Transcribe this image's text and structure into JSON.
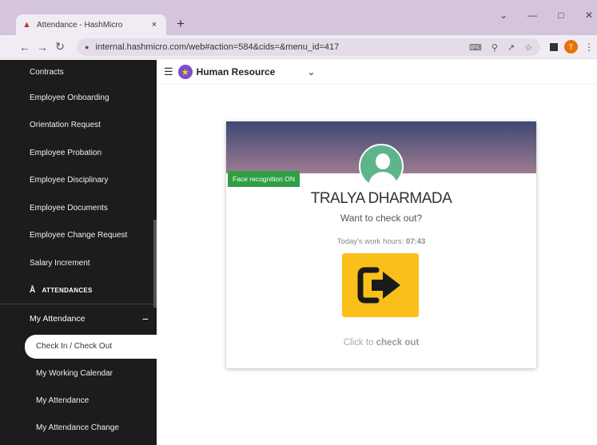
{
  "browser": {
    "tab_title": "Attendance - HashMicro",
    "tab_close": "×",
    "new_tab": "+",
    "url": "internal.hashmicro.com/web#action=584&cids=&menu_id=417",
    "profile_initial": "T"
  },
  "app": {
    "name": "Human Resource"
  },
  "sidebar": {
    "items": [
      "Contracts",
      "Employee Onboarding",
      "Orientation Request",
      "Employee Probation",
      "Employee Disciplinary",
      "Employee Documents",
      "Employee Change Request",
      "Salary Increment"
    ],
    "section": "ATTENDANCES",
    "group": "My Attendance",
    "group_toggle": "−",
    "subitems": [
      "Check In / Check Out",
      "My Working Calendar",
      "My Attendance",
      "My Attendance Change"
    ]
  },
  "checkin": {
    "face_badge": "Face recognition ON",
    "employee_name": "TRALYA DHARMADA",
    "question": "Want to check out?",
    "hours_label": "Today's work hours:",
    "hours_value": "07:43",
    "hint_prefix": "Click to",
    "hint_action": "check out"
  },
  "colors": {
    "sidebar_bg": "#1c1c1c",
    "button_yellow": "#fbbf1a",
    "badge_green": "#2ea043"
  }
}
